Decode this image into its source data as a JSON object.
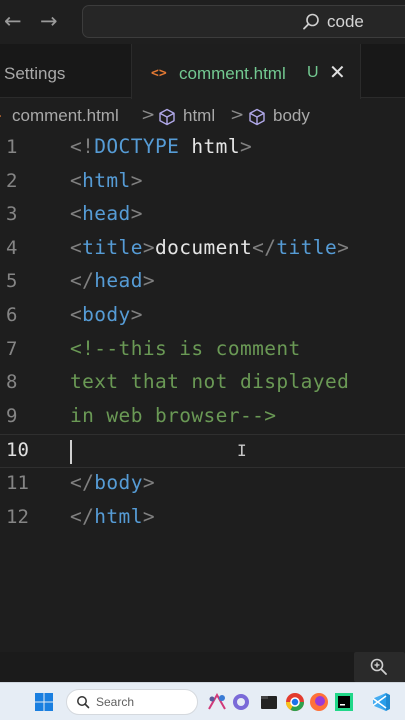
{
  "titlebar": {
    "back_label": "←",
    "forward_label": "→",
    "search_text": "code"
  },
  "tabs": {
    "settings_label": "Settings",
    "active_label": "comment.html",
    "active_status": "U",
    "close_label": "✕"
  },
  "breadcrumb": {
    "file": "comment.html",
    "sep": ">",
    "level1": "html",
    "level2": "body"
  },
  "editor": {
    "current_line": 10,
    "lines": [
      {
        "n": "1",
        "parts": [
          [
            "br",
            "<!"
          ],
          [
            "tag",
            "DOCTYPE"
          ],
          [
            "txt",
            " "
          ],
          [
            "txt",
            "html"
          ],
          [
            "br",
            ">"
          ]
        ]
      },
      {
        "n": "2",
        "parts": [
          [
            "br",
            "<"
          ],
          [
            "tag",
            "html"
          ],
          [
            "br",
            ">"
          ]
        ]
      },
      {
        "n": "3",
        "parts": [
          [
            "br",
            "<"
          ],
          [
            "tag",
            "head"
          ],
          [
            "br",
            ">"
          ]
        ]
      },
      {
        "n": "4",
        "parts": [
          [
            "br",
            "<"
          ],
          [
            "tag",
            "title"
          ],
          [
            "br",
            ">"
          ],
          [
            "txt",
            "document"
          ],
          [
            "br",
            "</"
          ],
          [
            "tag",
            "title"
          ],
          [
            "br",
            ">"
          ]
        ]
      },
      {
        "n": "5",
        "parts": [
          [
            "br",
            "</"
          ],
          [
            "tag",
            "head"
          ],
          [
            "br",
            ">"
          ]
        ]
      },
      {
        "n": "6",
        "parts": [
          [
            "br",
            "<"
          ],
          [
            "tag",
            "body"
          ],
          [
            "br",
            ">"
          ]
        ]
      },
      {
        "n": "7",
        "parts": [
          [
            "cmt",
            "<!--this is comment"
          ]
        ]
      },
      {
        "n": "8",
        "parts": [
          [
            "cmt",
            "text that not displayed"
          ]
        ]
      },
      {
        "n": "9",
        "parts": [
          [
            "cmt",
            "in web browser-->"
          ]
        ]
      },
      {
        "n": "10",
        "parts": []
      },
      {
        "n": "11",
        "parts": [
          [
            "br",
            "</"
          ],
          [
            "tag",
            "body"
          ],
          [
            "br",
            ">"
          ]
        ]
      },
      {
        "n": "12",
        "parts": [
          [
            "br",
            "</"
          ],
          [
            "tag",
            "html"
          ],
          [
            "br",
            ">"
          ]
        ]
      }
    ]
  },
  "taskbar": {
    "search_placeholder": "Search"
  },
  "colors": {
    "editor_bg": "#1e1e1e",
    "tag": "#569cd6",
    "bracket": "#808080",
    "comment": "#6a9955",
    "untracked": "#73c991",
    "html_icon": "#e37933"
  }
}
